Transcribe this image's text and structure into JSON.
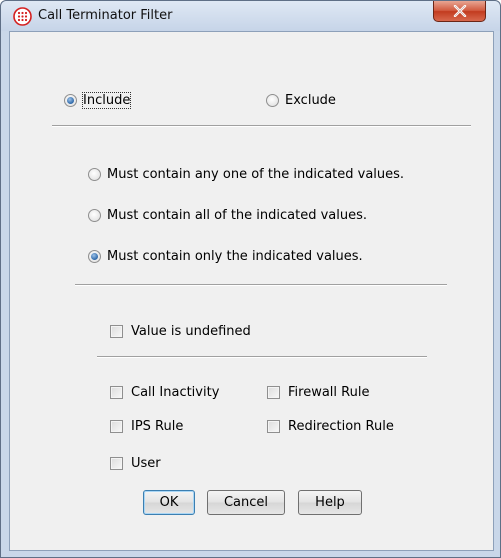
{
  "window": {
    "title": "Call Terminator Filter",
    "icon": "call-terminator-icon",
    "close_icon": "close-icon"
  },
  "mode": {
    "include_label": "Include",
    "exclude_label": "Exclude",
    "selected": "Include"
  },
  "match": {
    "options": [
      "Must contain any one of the indicated values.",
      "Must contain all of the indicated values.",
      "Must contain only the indicated values."
    ],
    "selected": "Must contain only the indicated values."
  },
  "undefined_label": "Value is undefined",
  "values": {
    "call_inactivity": "Call Inactivity",
    "firewall_rule": "Firewall Rule",
    "ips_rule": "IPS Rule",
    "redirection_rule": "Redirection Rule",
    "user": "User"
  },
  "buttons": {
    "ok": "OK",
    "cancel": "Cancel",
    "help": "Help"
  },
  "colors": {
    "close_button": "#c9442a",
    "radio_selected": "#2d67a8",
    "app_icon": "#d42020"
  }
}
